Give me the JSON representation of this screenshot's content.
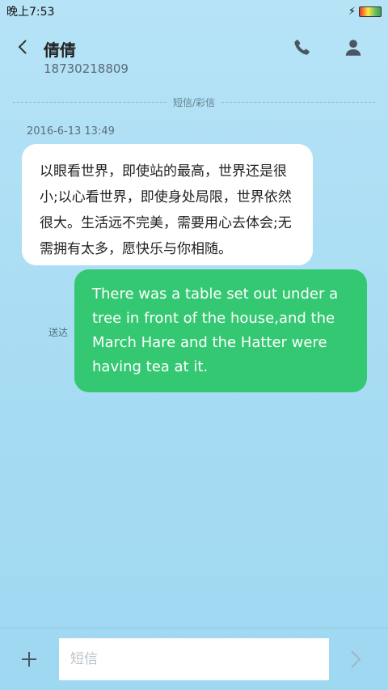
{
  "status_bar": {
    "time": "晚上7:53",
    "icons": [
      "charging-icon",
      "battery-icon"
    ]
  },
  "header": {
    "contact_name": "倩倩",
    "contact_number": "18730218809",
    "icons": [
      "back-arrow-icon",
      "phone-icon",
      "person-icon"
    ]
  },
  "conversation": {
    "channel_label": "短信/彩信",
    "timestamp": "2016-6-13 13:49",
    "incoming": {
      "text": "以眼看世界，即使站的最高，世界还是很小;以心看世界，即使身处局限，世界依然很大。生活远不完美，需要用心去体会;无需拥有太多，愿快乐与你相随。"
    },
    "outgoing": {
      "text": "There was a table set out under a tree in front of the house,and the March Hare and the Hatter were having tea at it.",
      "status": "送达"
    }
  },
  "composer": {
    "placeholder": "短信",
    "value": "",
    "icons": [
      "plus-icon",
      "send-arrow-icon"
    ]
  },
  "colors": {
    "background": "#a7dcf3",
    "incoming_bubble": "#ffffff",
    "outgoing_bubble": "#35c872"
  }
}
